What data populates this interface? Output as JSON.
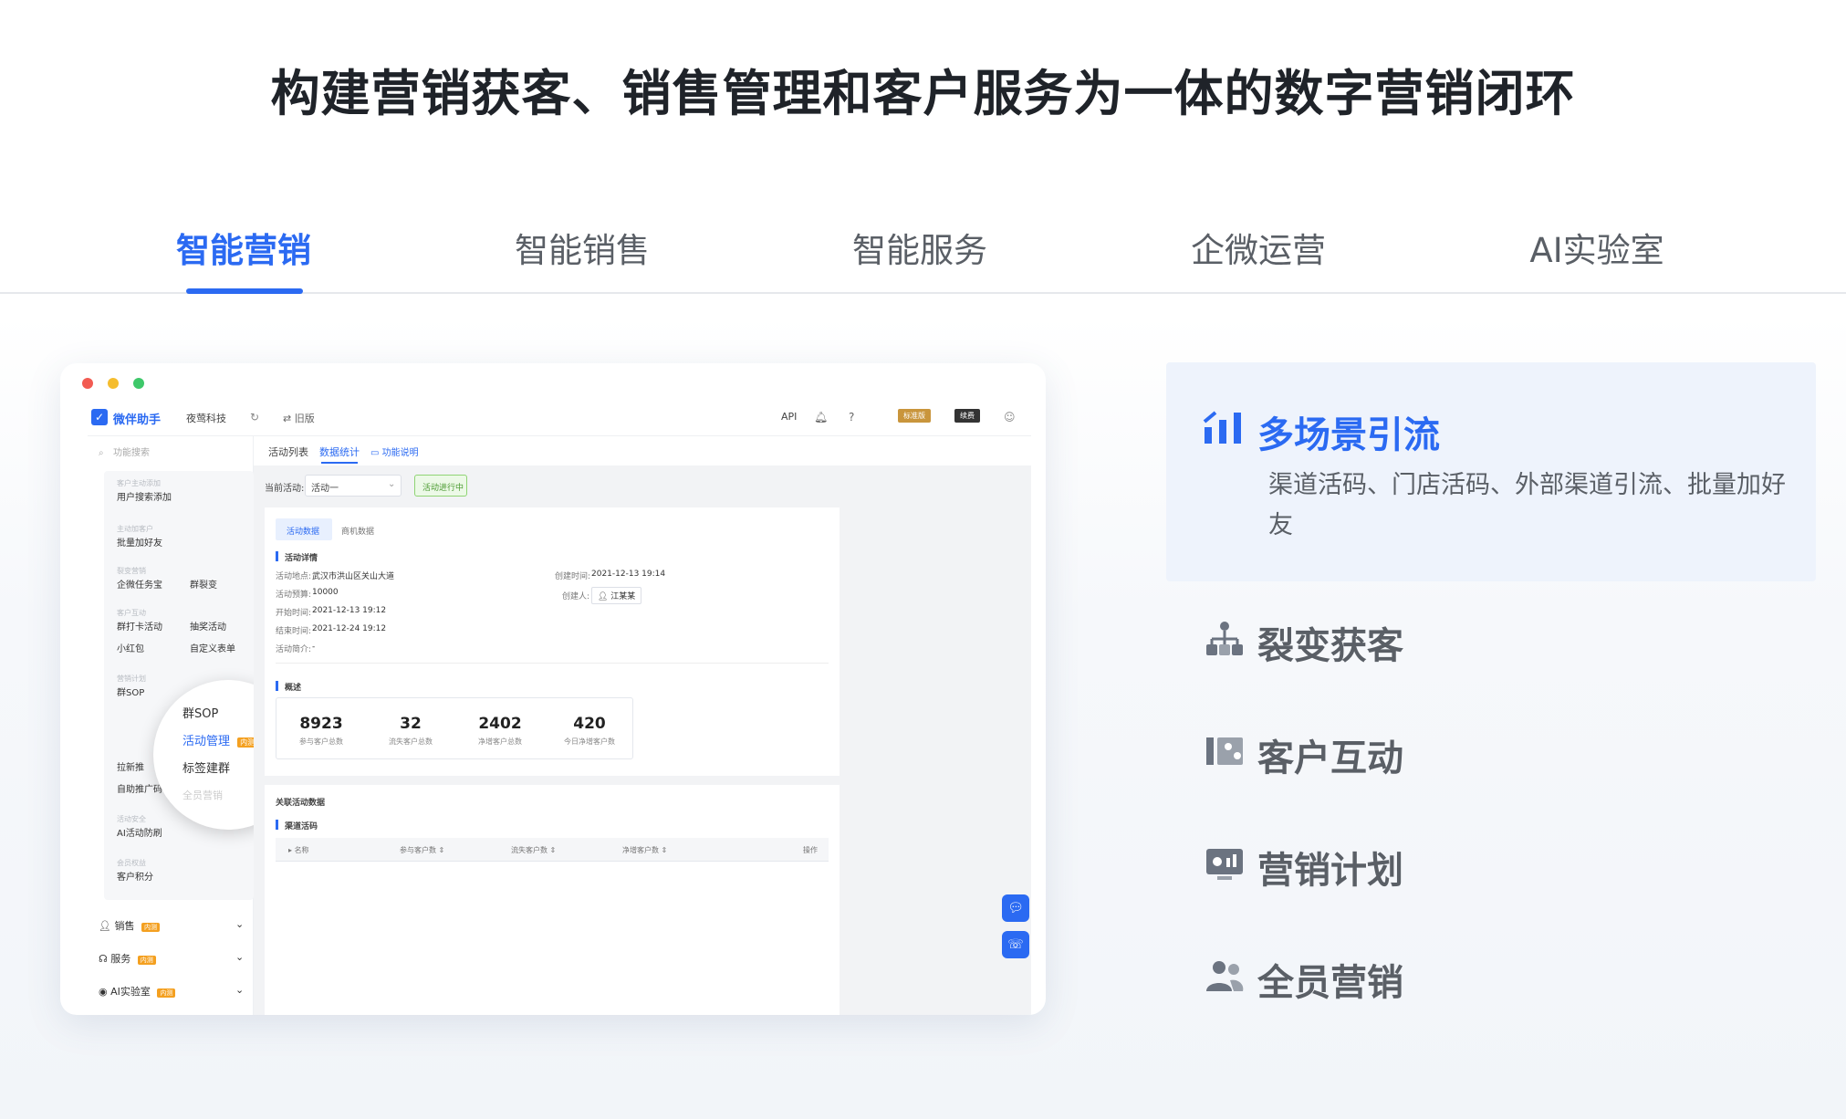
{
  "headline": "构建营销获客、销售管理和客户服务为一体的数字营销闭环",
  "tabs": [
    {
      "label": "智能营销",
      "active": true
    },
    {
      "label": "智能销售"
    },
    {
      "label": "智能服务"
    },
    {
      "label": "企微运营"
    },
    {
      "label": "AI实验室"
    }
  ],
  "colors": {
    "accent": "#2b6af2",
    "text": "#1f2329",
    "muted": "#5a5f66",
    "active_bg": "#eef3fc"
  },
  "app": {
    "brand": "微伴助手",
    "org": "夜莺科技",
    "old_version": "⇄ 旧版",
    "api": "API",
    "badge_dark": "续费",
    "badge_gold": "标准版",
    "search_placeholder": "功能搜索",
    "sidebar": {
      "cat1": "客户主动添加",
      "item1": "用户搜索添加",
      "cat2": "主动加客户",
      "item2": "批量加好友",
      "cat3": "裂变营销",
      "item3a": "企微任务宝",
      "item3b": "群裂变",
      "cat4": "客户互动",
      "item4a": "群打卡活动",
      "item4b": "抽奖活动",
      "item4c": "小红包",
      "item4d": "自定义表单",
      "cat5": "营销计划",
      "item5": "群SOP",
      "item6": "拉新推",
      "item7": "自助推广码",
      "cat8": "活动安全",
      "item8": "AI活动防刷",
      "cat9": "会员权益",
      "item9": "客户积分",
      "group_sales": "销售",
      "group_service": "服务",
      "group_ai": "AI实验室",
      "badge_new": "内测"
    },
    "magnifier": {
      "item1": "群SOP",
      "item2": "活动管理",
      "item2_badge": "内测",
      "item3": "标签建群",
      "item4": "全员营销"
    },
    "subnav": {
      "tab1": "活动列表",
      "tab2": "数据统计",
      "tab3": "功能说明"
    },
    "filter": {
      "label": "当前活动:",
      "value": "活动一",
      "status": "活动进行中"
    },
    "detail": {
      "tab_active": "活动数据",
      "tab2": "商机数据",
      "section": "活动详情",
      "location_label": "活动地点:",
      "location": "武汉市洪山区关山大道",
      "budget_label": "活动预算:",
      "budget": "10000",
      "start_label": "开始时间:",
      "start": "2021-12-13 19:12",
      "end_label": "结束时间:",
      "end": "2021-12-24 19:12",
      "intro_label": "活动简介:",
      "intro": "-",
      "created_label": "创建时间:",
      "created": "2021-12-13 19:14",
      "creator_label": "创建人:",
      "creator": "江某某"
    },
    "overview": {
      "title": "概述",
      "stats": [
        {
          "value": "8923",
          "label": "参与客户总数"
        },
        {
          "value": "32",
          "label": "流失客户总数"
        },
        {
          "value": "2402",
          "label": "净增客户总数"
        },
        {
          "value": "420",
          "label": "今日净增客户数"
        }
      ]
    },
    "related": {
      "title": "关联活动数据",
      "section": "渠道活码",
      "columns": [
        "名称",
        "参与客户数",
        "流失客户数",
        "净增客户数",
        "操作"
      ]
    }
  },
  "features": [
    {
      "title": "多场景引流",
      "desc": "渠道活码、门店活码、外部渠道引流、批量加好友",
      "icon": "bar-chart-icon",
      "active": true
    },
    {
      "title": "裂变获客",
      "icon": "hierarchy-icon"
    },
    {
      "title": "客户互动",
      "icon": "interaction-icon"
    },
    {
      "title": "营销计划",
      "icon": "monitor-chart-icon"
    },
    {
      "title": "全员营销",
      "icon": "users-icon"
    }
  ]
}
